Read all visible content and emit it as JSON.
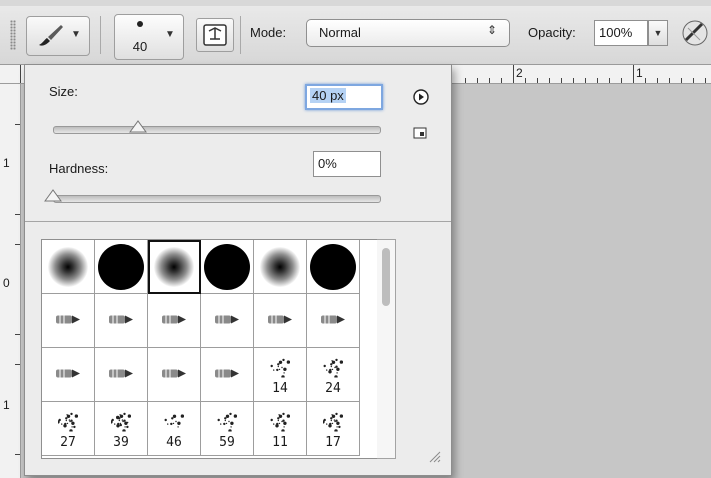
{
  "options_bar": {
    "brush_size": "40",
    "mode_label": "Mode:",
    "mode_value": "Normal",
    "opacity_label": "Opacity:",
    "opacity_value": "100%"
  },
  "ruler": {
    "top_labels": [
      "2",
      "1"
    ],
    "left_labels": [
      "1",
      "0",
      "1"
    ]
  },
  "brush_panel": {
    "size_label": "Size:",
    "size_value": "40 px",
    "hardness_label": "Hardness:",
    "hardness_value": "0%",
    "size_slider_fraction": 0.26,
    "hardness_slider_fraction": 0.0,
    "presets": [
      {
        "kind": "soft",
        "num": ""
      },
      {
        "kind": "hard",
        "num": ""
      },
      {
        "kind": "soft",
        "num": "",
        "selected": true
      },
      {
        "kind": "hard",
        "num": ""
      },
      {
        "kind": "soft",
        "num": ""
      },
      {
        "kind": "hard",
        "num": ""
      },
      {
        "kind": "bristle",
        "num": ""
      },
      {
        "kind": "bristle",
        "num": ""
      },
      {
        "kind": "bristle",
        "num": ""
      },
      {
        "kind": "bristle",
        "num": ""
      },
      {
        "kind": "bristle",
        "num": ""
      },
      {
        "kind": "bristle",
        "num": ""
      },
      {
        "kind": "bristle",
        "num": ""
      },
      {
        "kind": "bristle",
        "num": ""
      },
      {
        "kind": "bristle",
        "num": ""
      },
      {
        "kind": "bristle",
        "num": ""
      },
      {
        "kind": "scatter",
        "num": "14"
      },
      {
        "kind": "scatter",
        "num": "24"
      },
      {
        "kind": "scatter",
        "num": "27"
      },
      {
        "kind": "scatter",
        "num": "39"
      },
      {
        "kind": "scatter",
        "num": "46"
      },
      {
        "kind": "scatter",
        "num": "59"
      },
      {
        "kind": "scatter",
        "num": "11"
      },
      {
        "kind": "scatter",
        "num": "17"
      }
    ]
  },
  "colors": {
    "panel_bg": "#ececec",
    "canvas_bg": "#c6c6c6",
    "focus_ring": "#7ea7e0"
  },
  "icons": [
    "brush-tool-icon",
    "brush-preset-dot-icon",
    "airbrush-toggle-icon",
    "play-menu-icon",
    "save-preset-icon",
    "resize-grip-icon"
  ]
}
